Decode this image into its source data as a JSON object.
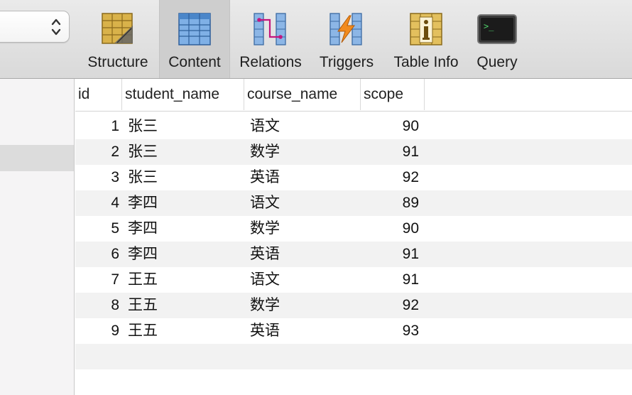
{
  "toolbar": {
    "tabs": [
      {
        "label": "Structure",
        "icon": "structure-icon"
      },
      {
        "label": "Content",
        "icon": "content-icon",
        "active": true
      },
      {
        "label": "Relations",
        "icon": "relations-icon"
      },
      {
        "label": "Triggers",
        "icon": "triggers-icon"
      },
      {
        "label": "Table Info",
        "icon": "table-info-icon"
      },
      {
        "label": "Query",
        "icon": "query-icon"
      }
    ],
    "query_prompt": ">_"
  },
  "table": {
    "columns": [
      "id",
      "student_name",
      "course_name",
      "scope"
    ],
    "rows": [
      {
        "id": "1",
        "student_name": "张三",
        "course_name": "语文",
        "scope": "90"
      },
      {
        "id": "2",
        "student_name": "张三",
        "course_name": "数学",
        "scope": "91"
      },
      {
        "id": "3",
        "student_name": "张三",
        "course_name": "英语",
        "scope": "92"
      },
      {
        "id": "4",
        "student_name": "李四",
        "course_name": "语文",
        "scope": "89"
      },
      {
        "id": "5",
        "student_name": "李四",
        "course_name": "数学",
        "scope": "90"
      },
      {
        "id": "6",
        "student_name": "李四",
        "course_name": "英语",
        "scope": "91"
      },
      {
        "id": "7",
        "student_name": "王五",
        "course_name": "语文",
        "scope": "91"
      },
      {
        "id": "8",
        "student_name": "王五",
        "course_name": "数学",
        "scope": "92"
      },
      {
        "id": "9",
        "student_name": "王五",
        "course_name": "英语",
        "scope": "93"
      }
    ]
  },
  "colors": {
    "toolbar_bg": "#dedede",
    "active_tab_bg": "#cecece",
    "row_alt_bg": "#f2f2f2",
    "sidebar_bg": "#f5f4f5",
    "sidebar_selected_bg": "#dcdcdc"
  }
}
